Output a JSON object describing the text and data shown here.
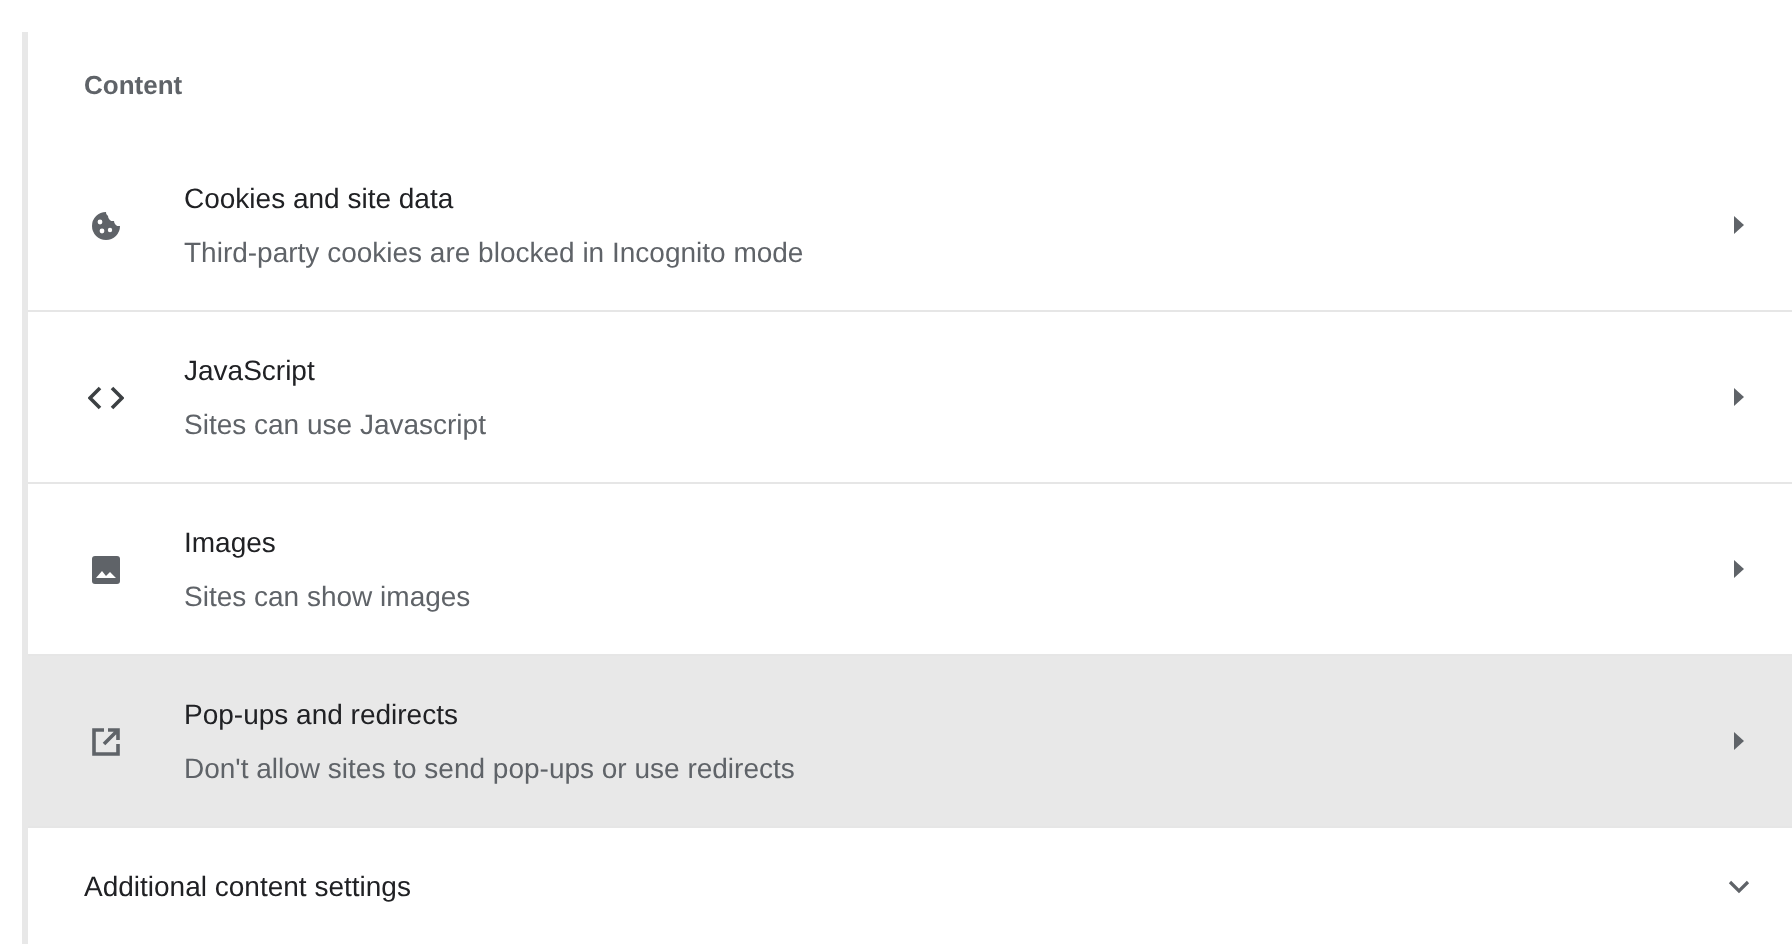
{
  "section": {
    "title": "Content"
  },
  "rows": [
    {
      "kind": "link",
      "title": "Cookies and site data",
      "subtitle": "Third-party cookies are blocked in Incognito mode",
      "selected": false
    },
    {
      "kind": "link",
      "title": "JavaScript",
      "subtitle": "Sites can use Javascript",
      "selected": false
    },
    {
      "kind": "link",
      "title": "Images",
      "subtitle": "Sites can show images",
      "selected": false
    },
    {
      "kind": "link",
      "title": "Pop-ups and redirects",
      "subtitle": "Don't allow sites to send pop-ups or use redirects",
      "selected": true
    },
    {
      "kind": "expand",
      "title": "Additional content settings",
      "selected": false
    }
  ]
}
